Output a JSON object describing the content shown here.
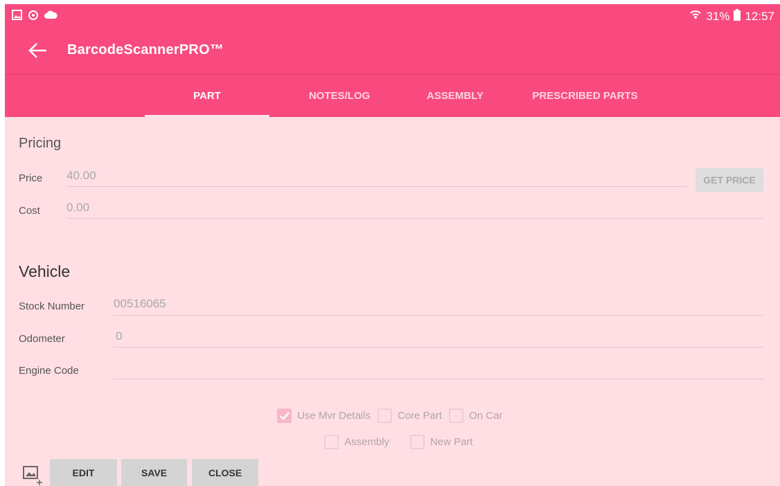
{
  "status_bar": {
    "battery": "31%",
    "time": "12:57",
    "icons": [
      "gallery-icon",
      "sync-icon",
      "cloud-icon",
      "wifi-icon",
      "battery-icon"
    ]
  },
  "app_bar": {
    "title": "BarcodeScannerPRO™"
  },
  "tabs": [
    {
      "label": "PART",
      "active": true
    },
    {
      "label": "NOTES/LOG",
      "active": false
    },
    {
      "label": "ASSEMBLY",
      "active": false
    },
    {
      "label": "PRESCRIBED PARTS",
      "active": false
    }
  ],
  "pricing": {
    "title": "Pricing",
    "price_label": "Price",
    "price_value": "40.00",
    "cost_label": "Cost",
    "cost_value": "0.00",
    "get_price_button": "GET PRICE"
  },
  "vehicle": {
    "title": "Vehicle",
    "stock_label": "Stock Number",
    "stock_value": "00516065",
    "odometer_label": "Odometer",
    "odometer_value": "0",
    "engine_label": "Engine Code",
    "engine_value": ""
  },
  "options": {
    "use_mvr": {
      "label": "Use Mvr Details",
      "checked": true
    },
    "core_part": {
      "label": "Core Part",
      "checked": false
    },
    "on_car": {
      "label": "On Car",
      "checked": false
    },
    "assembly": {
      "label": "Assembly",
      "checked": false
    },
    "new_part": {
      "label": "New Part",
      "checked": false
    }
  },
  "bottom_buttons": {
    "edit": "EDIT",
    "save": "SAVE",
    "close": "CLOSE"
  },
  "colors": {
    "accent": "#f94a7f",
    "content_bg": "#ffdfe4"
  }
}
